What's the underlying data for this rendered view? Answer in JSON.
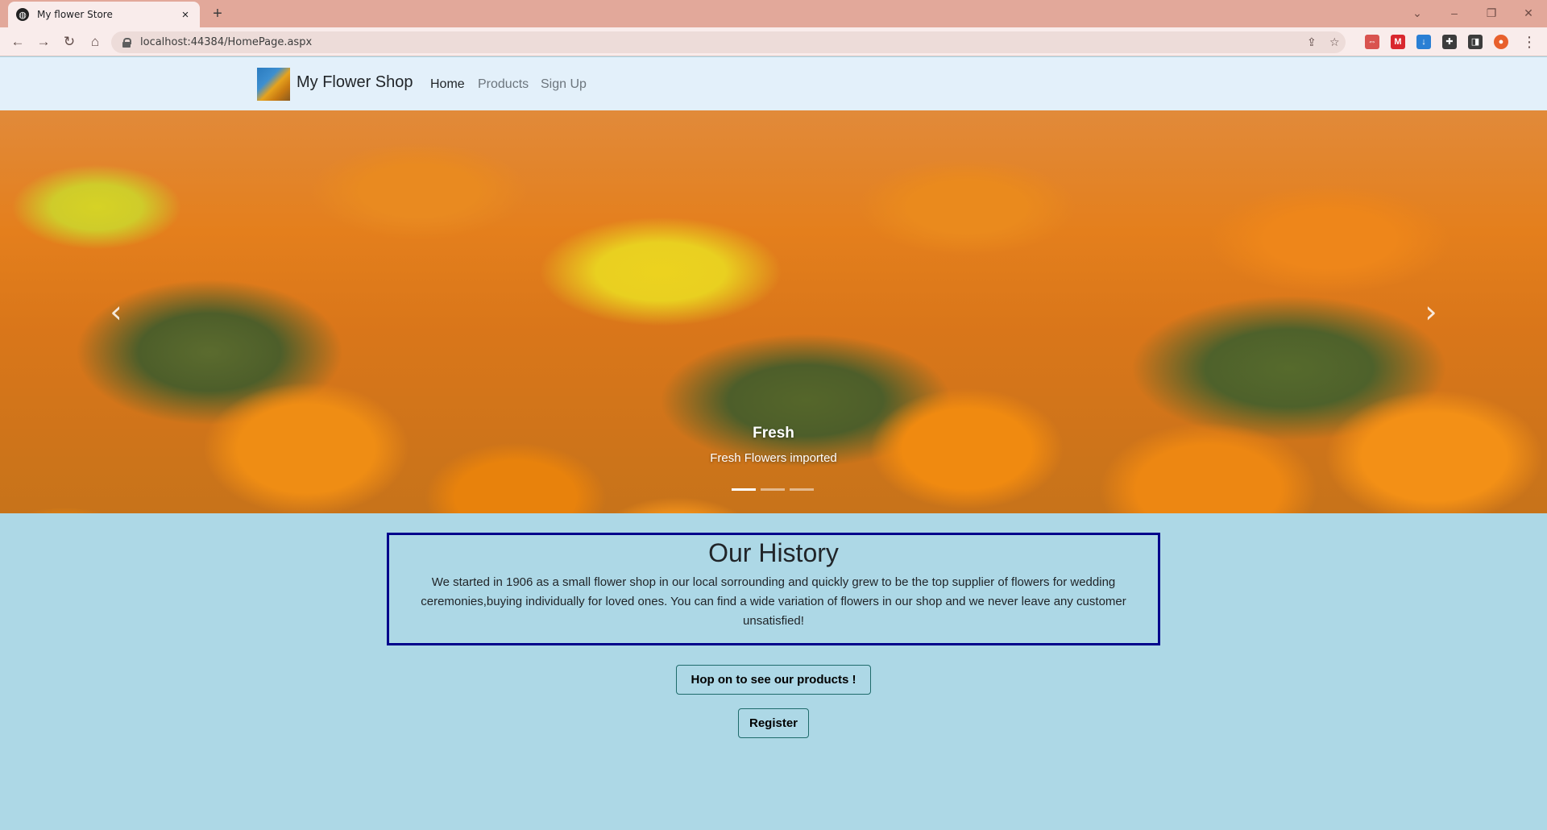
{
  "browser": {
    "tab_title": "My flower Store",
    "tab_close": "×",
    "new_tab": "+",
    "url": "localhost:44384/HomePage.aspx",
    "controls": {
      "chevron": "⌄",
      "minimize": "–",
      "restore": "❐",
      "close": "✕"
    },
    "nav": {
      "back": "←",
      "forward": "→",
      "reload": "↻",
      "home": "⌂"
    },
    "omnibox_icons": {
      "share": "⇪",
      "bookmark": "☆"
    },
    "extensions": [
      {
        "name": "pin-extension",
        "glyph": "⇔",
        "color": "#d9534f"
      },
      {
        "name": "mega-extension",
        "glyph": "M",
        "color": "#d9272e"
      },
      {
        "name": "download-extension",
        "glyph": "↓",
        "color": "#2a7fd4"
      },
      {
        "name": "puzzle-extension",
        "glyph": "✚",
        "color": "#3c3c3c"
      },
      {
        "name": "sidepanel-extension",
        "glyph": "◨",
        "color": "#3c3c3c"
      },
      {
        "name": "profile-avatar",
        "glyph": "●",
        "color": "#e8602c"
      }
    ],
    "menu": "⋮"
  },
  "navbar": {
    "brand": "My Flower Shop",
    "links": [
      {
        "label": "Home",
        "active": true
      },
      {
        "label": "Products",
        "active": false
      },
      {
        "label": "Sign Up",
        "active": false
      }
    ]
  },
  "carousel": {
    "prev_icon": "‹",
    "next_icon": "›",
    "slide_title": "Fresh",
    "slide_text": "Fresh Flowers imported",
    "slide_count": 3,
    "active_slide": 1
  },
  "history": {
    "heading": "Our History",
    "body": "We started in 1906 as a small flower shop in our local sorrounding and quickly grew to be the top supplier of flowers for wedding ceremonies,buying individually for loved ones. You can find a wide variation of flowers in our shop and we never leave any customer unsatisfied!"
  },
  "buttons": {
    "products": "Hop on to see our products !",
    "register": "Register"
  },
  "colors": {
    "page_background": "#add8e6",
    "history_border": "#00008b",
    "navbar_background": "#e3f0fa",
    "tabstrip": "#e2a89a"
  }
}
